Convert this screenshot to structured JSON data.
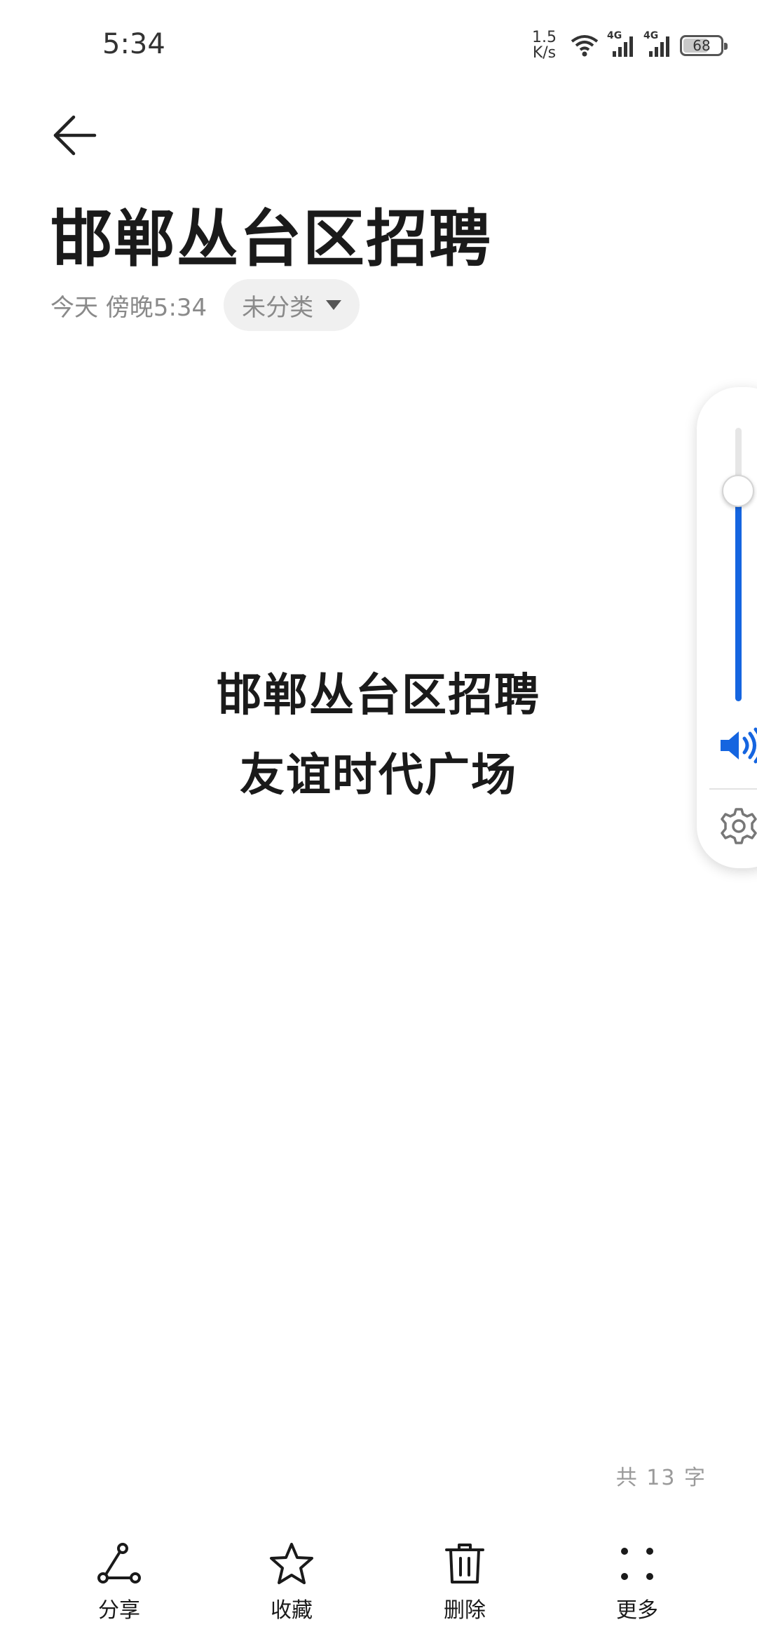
{
  "status_bar": {
    "time": "5:34",
    "net_speed_value": "1.5",
    "net_speed_unit": "K/s",
    "signal1": "4G",
    "signal2": "4G",
    "battery": "68"
  },
  "note": {
    "title": "邯郸丛台区招聘",
    "date": "今天 傍晚5:34",
    "category": "未分类",
    "body_lines": [
      "邯郸丛台区招聘",
      "友谊时代广场"
    ],
    "word_count": "共 13 字"
  },
  "volume": {
    "level": 0.77,
    "accent": "#1565e0"
  },
  "toolbar": {
    "share": "分享",
    "favorite": "收藏",
    "delete": "删除",
    "more": "更多"
  },
  "icons": {
    "back": "arrow-left-icon",
    "share": "share-icon",
    "favorite": "star-icon",
    "delete": "trash-icon",
    "more": "more-dots-icon",
    "speaker": "speaker-icon",
    "settings": "gear-icon"
  }
}
